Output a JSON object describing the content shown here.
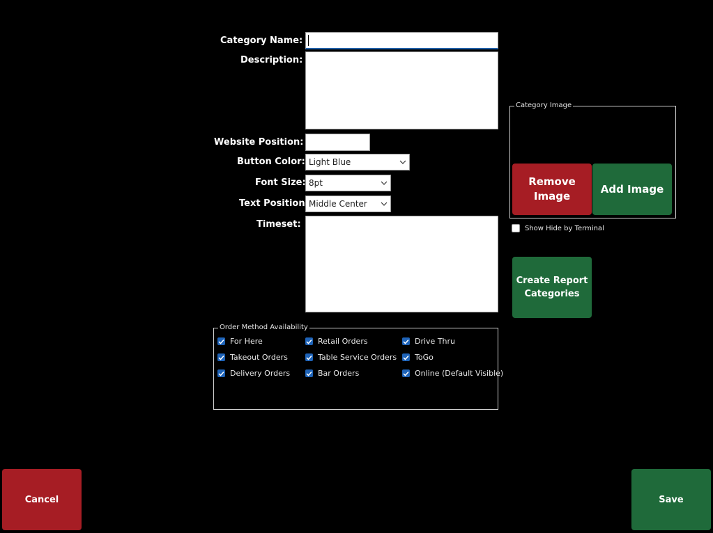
{
  "form": {
    "category_name_label": "Category Name:",
    "category_name_value": "",
    "description_label": "Description:",
    "description_value": "",
    "website_position_label": "Website Position:",
    "website_position_value": "",
    "button_color_label": "Button Color:",
    "button_color_value": "Light Blue",
    "font_size_label": "Font Size:",
    "font_size_value": "8pt",
    "text_position_label": "Text Position:",
    "text_position_value": "Middle Center",
    "timeset_label": "Timeset:",
    "timeset_value": ""
  },
  "category_image": {
    "legend": "Category Image",
    "remove_line1": "Remove",
    "remove_line2": "Image",
    "add_label": "Add Image"
  },
  "show_hide": {
    "label": "Show Hide by Terminal",
    "checked": false
  },
  "report": {
    "line1": "Create Report",
    "line2": "Categories"
  },
  "order_methods": {
    "legend": "Order Method Availability",
    "items": [
      {
        "label": "For Here",
        "checked": true
      },
      {
        "label": "Takeout Orders",
        "checked": true
      },
      {
        "label": "Delivery Orders",
        "checked": true
      },
      {
        "label": "Retail Orders",
        "checked": true
      },
      {
        "label": "Table Service Orders",
        "checked": true
      },
      {
        "label": "Bar Orders",
        "checked": true
      },
      {
        "label": "Drive Thru",
        "checked": true
      },
      {
        "label": "ToGo",
        "checked": true
      },
      {
        "label": "Online (Default Visible)",
        "checked": true
      }
    ]
  },
  "footer": {
    "cancel_label": "Cancel",
    "save_label": "Save"
  },
  "colors": {
    "background": "#000000",
    "cancel_red": "#a61d24",
    "save_green": "#1f6a3a",
    "checkbox_blue": "#1e63b8"
  }
}
